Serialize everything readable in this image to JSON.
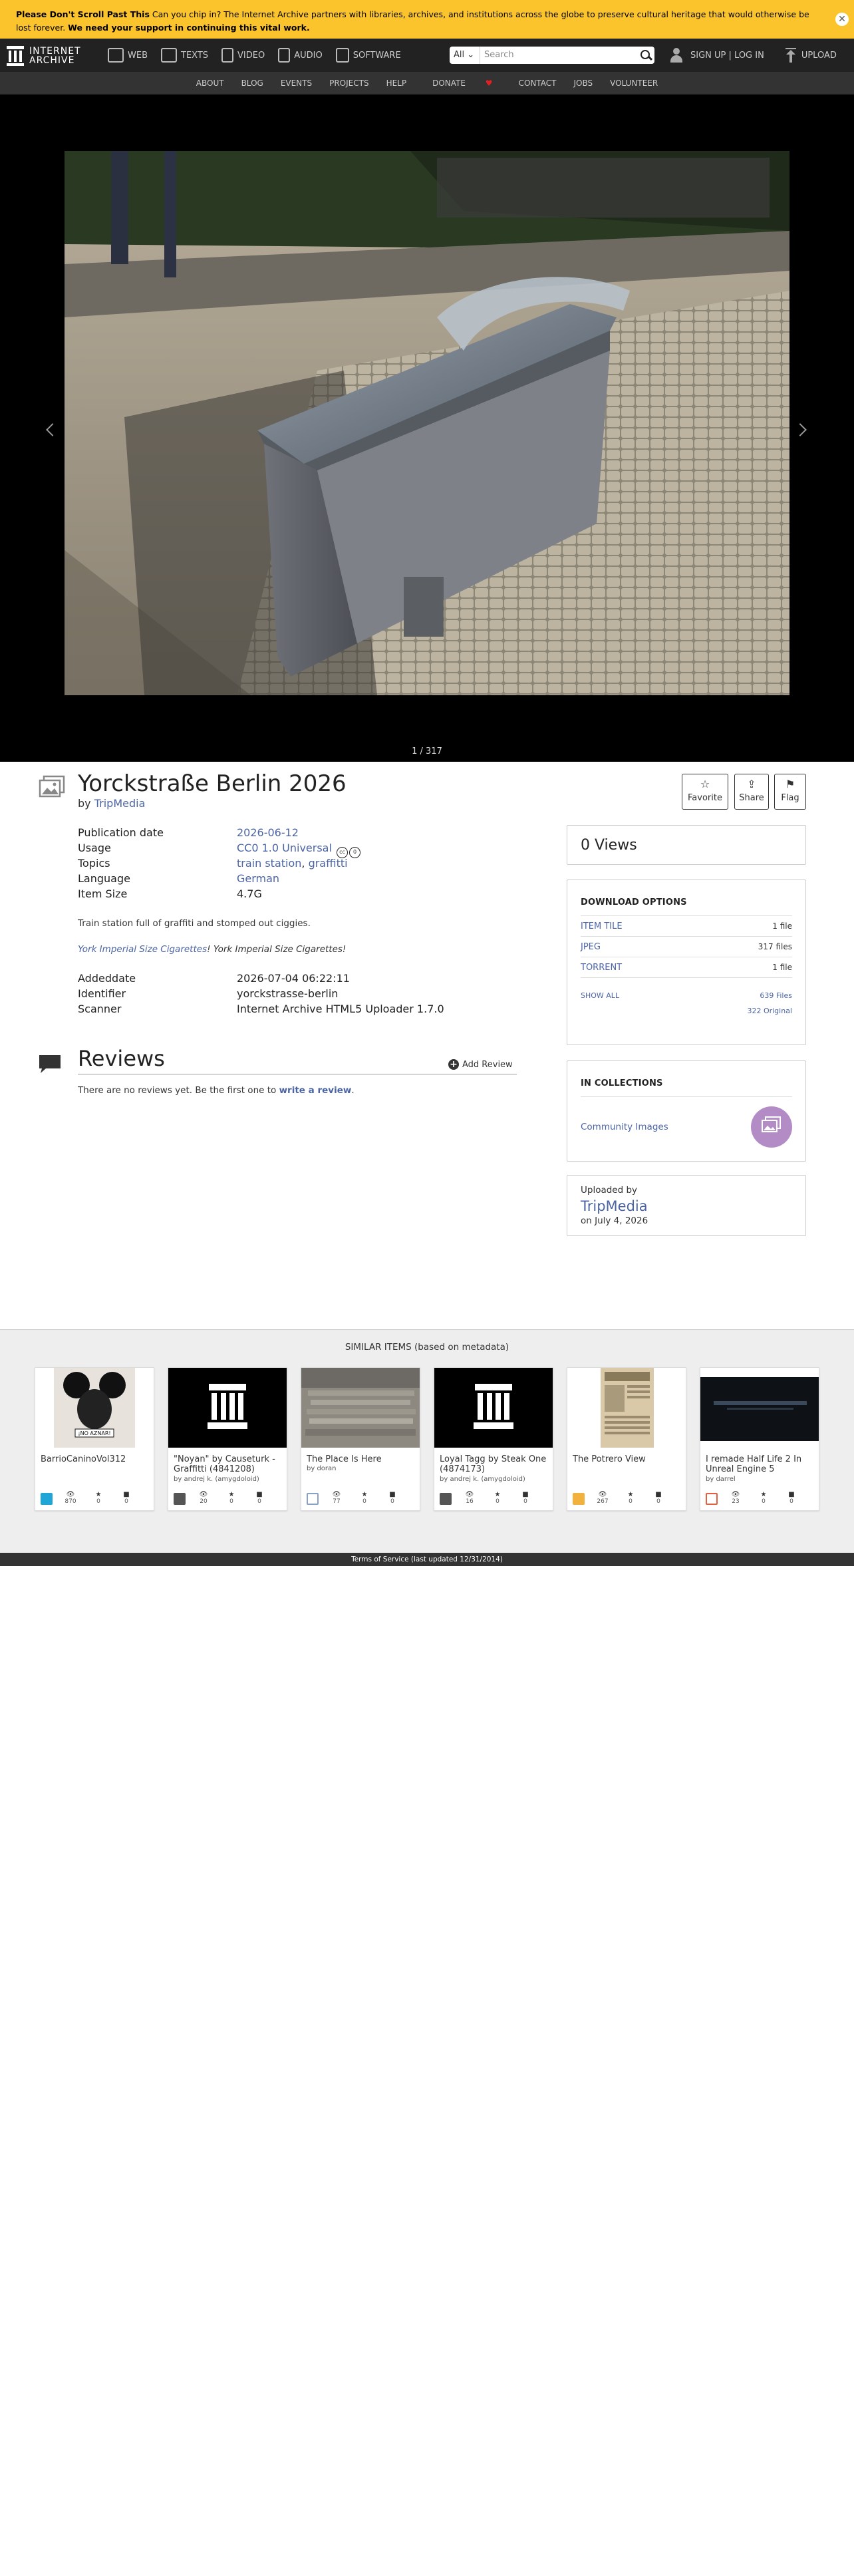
{
  "banner": {
    "bold_lead": "Please Don't Scroll Past This",
    "message": " Can you chip in? The Internet Archive partners with libraries, archives, and institutions across the globe to preserve cultural heritage that would otherwise be lost forever. ",
    "bold_tail": "We need your support in continuing this vital work.",
    "close_glyph": "✕"
  },
  "nav": {
    "logo_line1": "INTERNET",
    "logo_line2": "ARCHIVE",
    "mediatypes": [
      {
        "label": "WEB",
        "icon": "web-icon"
      },
      {
        "label": "TEXTS",
        "icon": "texts-icon"
      },
      {
        "label": "VIDEO",
        "icon": "video-icon"
      },
      {
        "label": "AUDIO",
        "icon": "audio-icon"
      },
      {
        "label": "SOFTWARE",
        "icon": "software-icon"
      }
    ],
    "search_scope": "All",
    "search_placeholder": "Search",
    "signup": "SIGN UP",
    "separator": "|",
    "login": "LOG IN",
    "upload": "UPLOAD"
  },
  "subnav": [
    "ABOUT",
    "BLOG",
    "EVENTS",
    "PROJECTS",
    "HELP",
    "DONATE",
    "CONTACT",
    "JOBS",
    "VOLUNTEER"
  ],
  "theater": {
    "pager": "1 / 317"
  },
  "item": {
    "title": "Yorckstraße Berlin 2026",
    "by_label": "by",
    "creator": "TripMedia",
    "actions": [
      {
        "label": "Favorite",
        "glyph": "☆"
      },
      {
        "label": "Share",
        "glyph": "⇪"
      },
      {
        "label": "Flag",
        "glyph": "⚑"
      }
    ]
  },
  "metadata": {
    "publication_date_label": "Publication date",
    "publication_date": "2026-06-12",
    "usage_label": "Usage",
    "usage": "CC0 1.0 Universal",
    "cc_badge_1": "cc",
    "cc_badge_2": "0",
    "topics_label": "Topics",
    "topic_1": "train station",
    "topic_sep": ", ",
    "topic_2": "graffitti",
    "language_label": "Language",
    "language": "German",
    "item_size_label": "Item Size",
    "item_size": "4.7G",
    "description": "Train station full of graffiti and stomped out ciggies.",
    "desc_link": "York Imperial Size Cigarettes",
    "desc_tail": "! York Imperial Size Cigarettes!",
    "addeddate_label": "Addeddate",
    "addeddate": "2026-07-04 06:22:11",
    "identifier_label": "Identifier",
    "identifier": "yorckstrasse-berlin",
    "scanner_label": "Scanner",
    "scanner": "Internet Archive HTML5 Uploader 1.7.0"
  },
  "reviews": {
    "title": "Reviews",
    "add_label": "Add Review",
    "empty_text": "There are no reviews yet. Be the first one to ",
    "empty_link": "write a review",
    "empty_end": "."
  },
  "views": {
    "text": "0 Views"
  },
  "downloads": {
    "title": "DOWNLOAD OPTIONS",
    "rows": [
      {
        "label": "ITEM TILE",
        "count": "1 file"
      },
      {
        "label": "JPEG",
        "count": "317 files"
      },
      {
        "label": "TORRENT",
        "count": "1 file"
      }
    ],
    "show_all": "SHOW ALL",
    "files": "639 Files",
    "original": "322 Original"
  },
  "collections": {
    "title": "IN COLLECTIONS",
    "name": "Community Images"
  },
  "uploader": {
    "label": "Uploaded by",
    "name": "TripMedia",
    "date": "on July 4, 2026"
  },
  "similar": {
    "title": "SIMILAR ITEMS (based on metadata)",
    "items": [
      {
        "title": "BarrioCaninoVol312",
        "by": "",
        "views": "870",
        "favs": "0",
        "reviews": "0",
        "type": "texts"
      },
      {
        "title": "\"Noyan\" by Causeturk - Graffitti (4841208)",
        "by": "by andrej k. (amygdoloid)",
        "views": "20",
        "favs": "0",
        "reviews": "0",
        "type": "collection"
      },
      {
        "title": "The Place Is Here",
        "by": "by doran",
        "views": "77",
        "favs": "0",
        "reviews": "0",
        "type": "image"
      },
      {
        "title": "Loyal Tagg by Steak One (4874173)",
        "by": "by andrej k. (amygdoloid)",
        "views": "16",
        "favs": "0",
        "reviews": "0",
        "type": "collection"
      },
      {
        "title": "The Potrero View",
        "by": "",
        "views": "267",
        "favs": "0",
        "reviews": "0",
        "type": "texts"
      },
      {
        "title": "I remade Half Life 2 In Unreal Engine 5",
        "by": "by darrel",
        "views": "23",
        "favs": "0",
        "reviews": "0",
        "type": "movies"
      }
    ]
  },
  "footer": {
    "text": "Terms of Service (last updated 12/31/2014)"
  },
  "colors": {
    "banner": "#fcc42c",
    "nav": "#222222",
    "link": "#4b64a4",
    "collection": "#b38cc6"
  }
}
